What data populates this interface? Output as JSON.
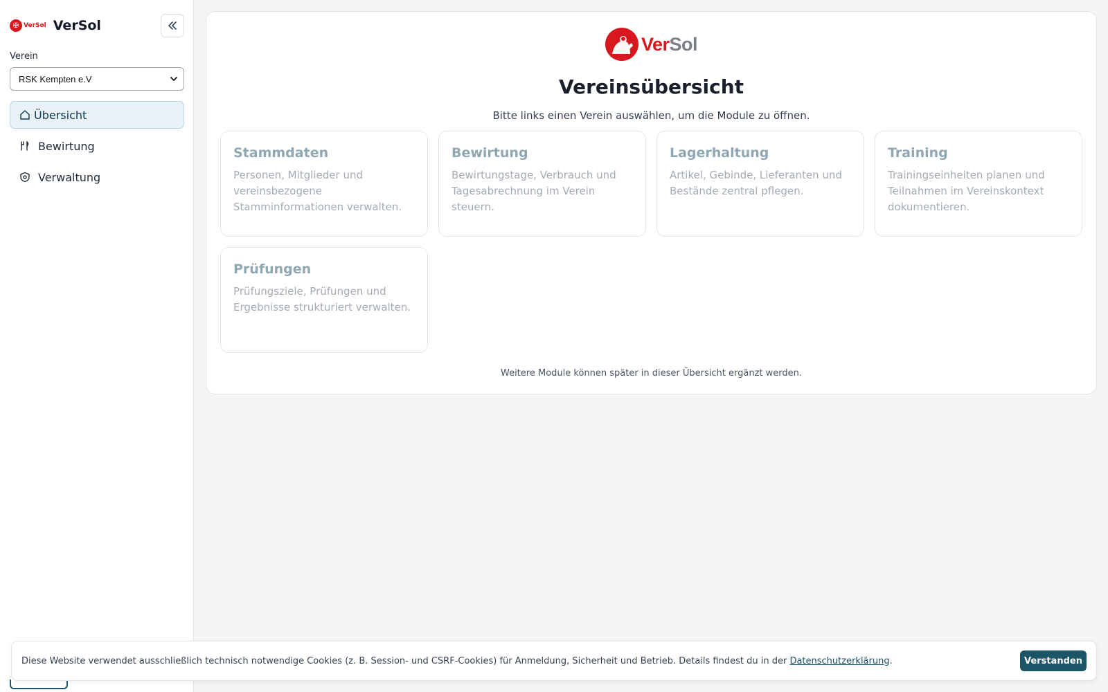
{
  "sidebar": {
    "brand_name": "VerSol",
    "brand_logo_text": "VerSol",
    "collapse_icon": "chevrons-left-icon",
    "verein_label": "Verein",
    "verein_selected": "RSK Kempten e.V",
    "nav": [
      {
        "label": "Übersicht",
        "icon": "home-icon",
        "active": true
      },
      {
        "label": "Bewirtung",
        "icon": "utensils-icon",
        "active": false
      },
      {
        "label": "Verwaltung",
        "icon": "shield-icon",
        "active": false
      }
    ]
  },
  "main": {
    "logo_ver": "Ver",
    "logo_sol": "Sol",
    "title": "Vereinsübersicht",
    "subtitle": "Bitte links einen Verein auswählen, um die Module zu öffnen.",
    "modules": [
      {
        "title": "Stammdaten",
        "description": "Personen, Mitglieder und vereinsbezogene Stamminformationen verwalten."
      },
      {
        "title": "Bewirtung",
        "description": "Bewirtungstage, Verbrauch und Tagesabrechnung im Verein steuern."
      },
      {
        "title": "Lagerhaltung",
        "description": "Artikel, Gebinde, Lieferanten und Bestände zentral pflegen."
      },
      {
        "title": "Training",
        "description": "Trainingseinheiten planen und Teilnahmen im Vereinskontext dokumentieren."
      },
      {
        "title": "Prüfungen",
        "description": "Prüfungsziele, Prüfungen und Ergebnisse strukturiert verwalten."
      }
    ],
    "footnote": "Weitere Module können später in dieser Übersicht ergänzt werden."
  },
  "cookie": {
    "text": "Diese Website verwendet ausschließlich technisch notwendige Cookies (z. B. Session- und CSRF-Cookies) für Anmeldung, Sicherheit und Betrieb. Details findest du in der ",
    "link": "Datenschutzerklärung",
    "after_link": ".",
    "button": "Verstanden"
  },
  "colors": {
    "brand_red": "#d7191f",
    "accent_teal": "#1d5568",
    "active_nav_bg": "#e8f1f6"
  }
}
